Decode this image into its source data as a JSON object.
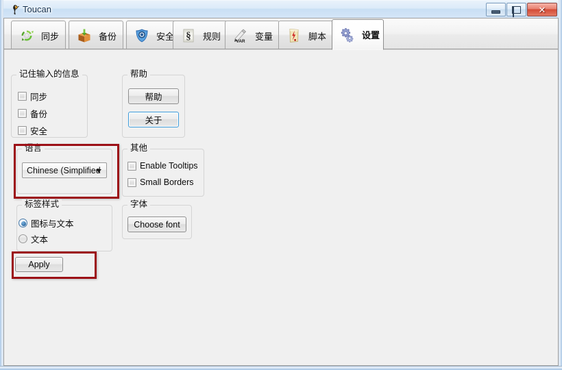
{
  "window": {
    "title": "Toucan",
    "icon": "toucan-icon",
    "controls": {
      "minimize": "minimize-button",
      "maximize": "maximize-button",
      "close": "close-button",
      "close_glyph": "✕"
    }
  },
  "tabs": [
    {
      "id": "sync",
      "label": "同步",
      "icon": "sync-icon",
      "active": false
    },
    {
      "id": "backup",
      "label": "备份",
      "icon": "backup-icon",
      "active": false
    },
    {
      "id": "secure",
      "label": "安全",
      "icon": "shield-icon",
      "active": false
    },
    {
      "id": "rules",
      "label": "规则",
      "icon": "rules-icon",
      "active": false
    },
    {
      "id": "variables",
      "label": "变量",
      "icon": "variables-icon",
      "active": false
    },
    {
      "id": "script",
      "label": "脚本",
      "icon": "script-icon",
      "active": false
    },
    {
      "id": "settings",
      "label": "设置",
      "icon": "settings-icon",
      "active": true
    }
  ],
  "settings_page": {
    "remember_group": {
      "title": "记住输入的信息",
      "items": [
        {
          "label": "同步",
          "checked": false
        },
        {
          "label": "备份",
          "checked": false
        },
        {
          "label": "安全",
          "checked": false
        }
      ]
    },
    "help_group": {
      "title": "帮助",
      "help_button": "帮助",
      "about_button": "关于"
    },
    "language_group": {
      "title": "语言",
      "selected": "Chinese (Simplified",
      "highlighted": true
    },
    "other_group": {
      "title": "其他",
      "items": [
        {
          "label": "Enable Tooltips",
          "checked": false
        },
        {
          "label": "Small Borders",
          "checked": false
        }
      ]
    },
    "tabstyle_group": {
      "title": "标签样式",
      "options": [
        {
          "label": "图标与文本",
          "selected": true
        },
        {
          "label": "文本",
          "selected": false
        }
      ]
    },
    "font_group": {
      "title": "字体",
      "choose_font_button": "Choose font"
    },
    "apply_button": "Apply"
  },
  "colors": {
    "highlight_red": "#9c0f16",
    "focus_blue": "#3c9ad8",
    "page_background": "#f0f0f0",
    "title_text": "#15314f"
  }
}
